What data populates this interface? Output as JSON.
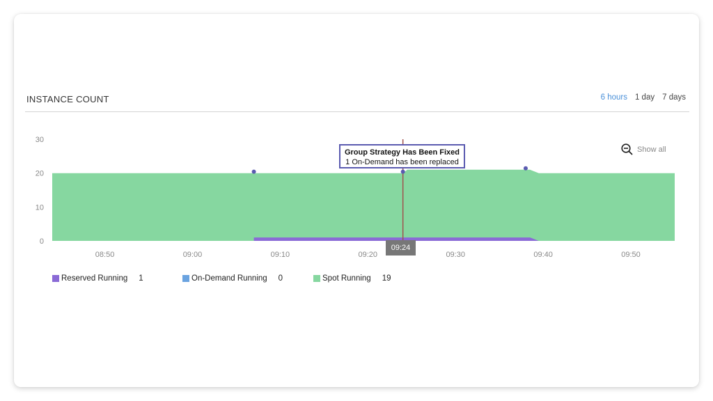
{
  "header": {
    "section_title": "INSTANCE COUNT",
    "ranges": [
      {
        "label": "6 hours",
        "active": true
      },
      {
        "label": "1 day",
        "active": false
      },
      {
        "label": "7 days",
        "active": false
      }
    ]
  },
  "tooltip": {
    "title": "Group Strategy Has Been Fixed",
    "body": "1 On-Demand has been replaced"
  },
  "marker_time": "09:24",
  "show_all_label": "Show all",
  "legend": [
    {
      "label": "Reserved Running",
      "value": "1",
      "color": "#8a6ad6"
    },
    {
      "label": "On-Demand Running",
      "value": "0",
      "color": "#6aa3e0"
    },
    {
      "label": "Spot Running",
      "value": "19",
      "color": "#86d7a0"
    }
  ],
  "chart_data": {
    "type": "area",
    "x_ticks": [
      "08:50",
      "09:00",
      "09:10",
      "09:20",
      "09:30",
      "09:40",
      "09:50"
    ],
    "y_ticks": [
      0,
      10,
      20,
      30
    ],
    "ylim": [
      0,
      30
    ],
    "x_range": [
      "08:44",
      "09:55"
    ],
    "series": [
      {
        "name": "Spot Running",
        "color": "#86d7a0",
        "points": [
          [
            "08:44",
            20
          ],
          [
            "09:24",
            20
          ],
          [
            "09:24.5",
            21
          ],
          [
            "09:38.5",
            21
          ],
          [
            "09:39.5",
            20
          ],
          [
            "09:55",
            20
          ]
        ]
      },
      {
        "name": "Reserved Running",
        "color": "#8a6ad6",
        "points": [
          [
            "08:44",
            0
          ],
          [
            "09:07",
            0
          ],
          [
            "09:07",
            1
          ],
          [
            "09:38.5",
            1
          ],
          [
            "09:39.5",
            0
          ],
          [
            "09:55",
            0
          ]
        ]
      }
    ],
    "event_markers": [
      [
        "09:07",
        20
      ],
      [
        "09:24",
        20
      ],
      [
        "09:38",
        21
      ]
    ],
    "cursor_time": "09:24",
    "grid": false
  }
}
